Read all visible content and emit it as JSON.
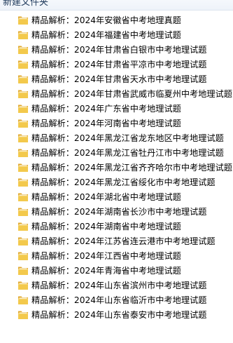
{
  "toolbar": {
    "new_folder_label": "新建文件夹"
  },
  "colors": {
    "folder_front": "#f3c94c",
    "folder_back": "#e0a82e",
    "folder_paper": "#ffffff",
    "hover_bg": "#e5f3ff"
  },
  "file_list": {
    "items": [
      {
        "name": "精品解析：2024年安徽省中考地理真题",
        "icon": "folder-icon"
      },
      {
        "name": "精品解析：2024年福建省中考地理试题",
        "icon": "folder-icon"
      },
      {
        "name": "精品解析：2024年甘肃省白银市中考地理试题",
        "icon": "folder-icon"
      },
      {
        "name": "精品解析：2024年甘肃省平凉市中考地理试题",
        "icon": "folder-icon"
      },
      {
        "name": "精品解析：2024年甘肃省天水市中考地理试题",
        "icon": "folder-icon"
      },
      {
        "name": "精品解析：2024年甘肃省武威市临夏州中考地理试题",
        "icon": "folder-icon"
      },
      {
        "name": "精品解析：2024年广东省中考地理试题",
        "icon": "folder-icon"
      },
      {
        "name": "精品解析：2024年河南省中考地理试题",
        "icon": "folder-icon"
      },
      {
        "name": "精品解析：2024年黑龙江省龙东地区中考地理试题",
        "icon": "folder-icon"
      },
      {
        "name": "精品解析：2024年黑龙江省牡丹江市中考地理试题",
        "icon": "folder-icon"
      },
      {
        "name": "精品解析：2024年黑龙江省齐齐哈尔市中考地理试题",
        "icon": "folder-icon"
      },
      {
        "name": "精品解析：2024年黑龙江省绥化市中考地理试题",
        "icon": "folder-icon"
      },
      {
        "name": "精品解析：2024年湖北省中考地理试题",
        "icon": "folder-icon"
      },
      {
        "name": "精品解析：2024年湖南省长沙市中考地理试题",
        "icon": "folder-icon"
      },
      {
        "name": "精品解析：2024年湖南省中考地理试题",
        "icon": "folder-icon"
      },
      {
        "name": "精品解析：2024年江苏省连云港市中考地理试题",
        "icon": "folder-icon"
      },
      {
        "name": "精品解析：2024年江西省中考地理试题",
        "icon": "folder-icon"
      },
      {
        "name": "精品解析：2024年青海省中考地理试题",
        "icon": "folder-icon"
      },
      {
        "name": "精品解析：2024年山东省滨州市中考地理试题",
        "icon": "folder-icon"
      },
      {
        "name": "精品解析：2024年山东省临沂市中考地理试题",
        "icon": "folder-icon"
      },
      {
        "name": "精品解析：2024年山东省泰安市中考地理试题",
        "icon": "folder-icon"
      }
    ]
  }
}
